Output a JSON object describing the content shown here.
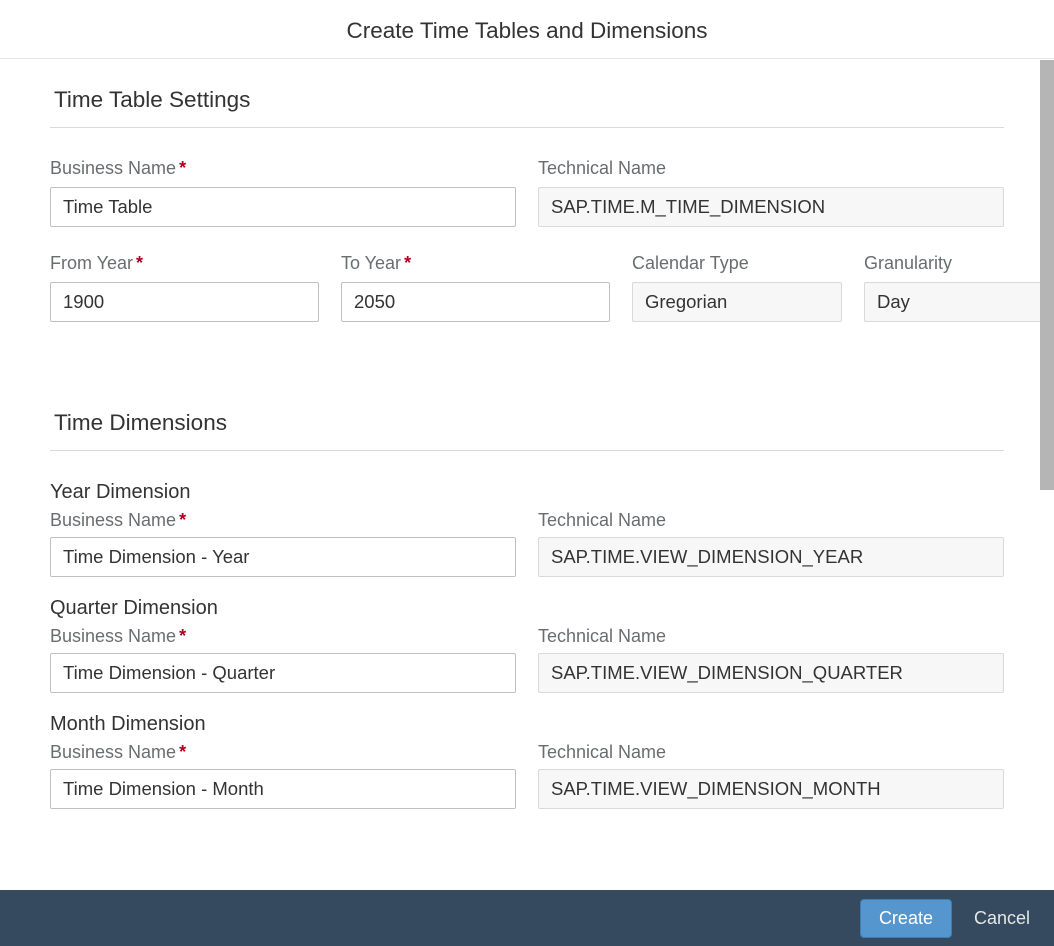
{
  "dialog": {
    "title": "Create Time Tables and Dimensions"
  },
  "sections": {
    "settings_title": "Time Table Settings",
    "dimensions_title": "Time Dimensions"
  },
  "settings": {
    "business_name_label": "Business Name",
    "business_name_value": "Time Table",
    "technical_name_label": "Technical Name",
    "technical_name_value": "SAP.TIME.M_TIME_DIMENSION",
    "from_year_label": "From Year",
    "from_year_value": "1900",
    "to_year_label": "To Year",
    "to_year_value": "2050",
    "calendar_type_label": "Calendar Type",
    "calendar_type_value": "Gregorian",
    "granularity_label": "Granularity",
    "granularity_value": "Day"
  },
  "dimensions": {
    "year": {
      "heading": "Year Dimension",
      "business_name_label": "Business Name",
      "business_name_value": "Time Dimension - Year",
      "technical_name_label": "Technical Name",
      "technical_name_value": "SAP.TIME.VIEW_DIMENSION_YEAR"
    },
    "quarter": {
      "heading": "Quarter Dimension",
      "business_name_label": "Business Name",
      "business_name_value": "Time Dimension - Quarter",
      "technical_name_label": "Technical Name",
      "technical_name_value": "SAP.TIME.VIEW_DIMENSION_QUARTER"
    },
    "month": {
      "heading": "Month Dimension",
      "business_name_label": "Business Name",
      "business_name_value": "Time Dimension - Month",
      "technical_name_label": "Technical Name",
      "technical_name_value": "SAP.TIME.VIEW_DIMENSION_MONTH"
    }
  },
  "footer": {
    "create_label": "Create",
    "cancel_label": "Cancel"
  }
}
